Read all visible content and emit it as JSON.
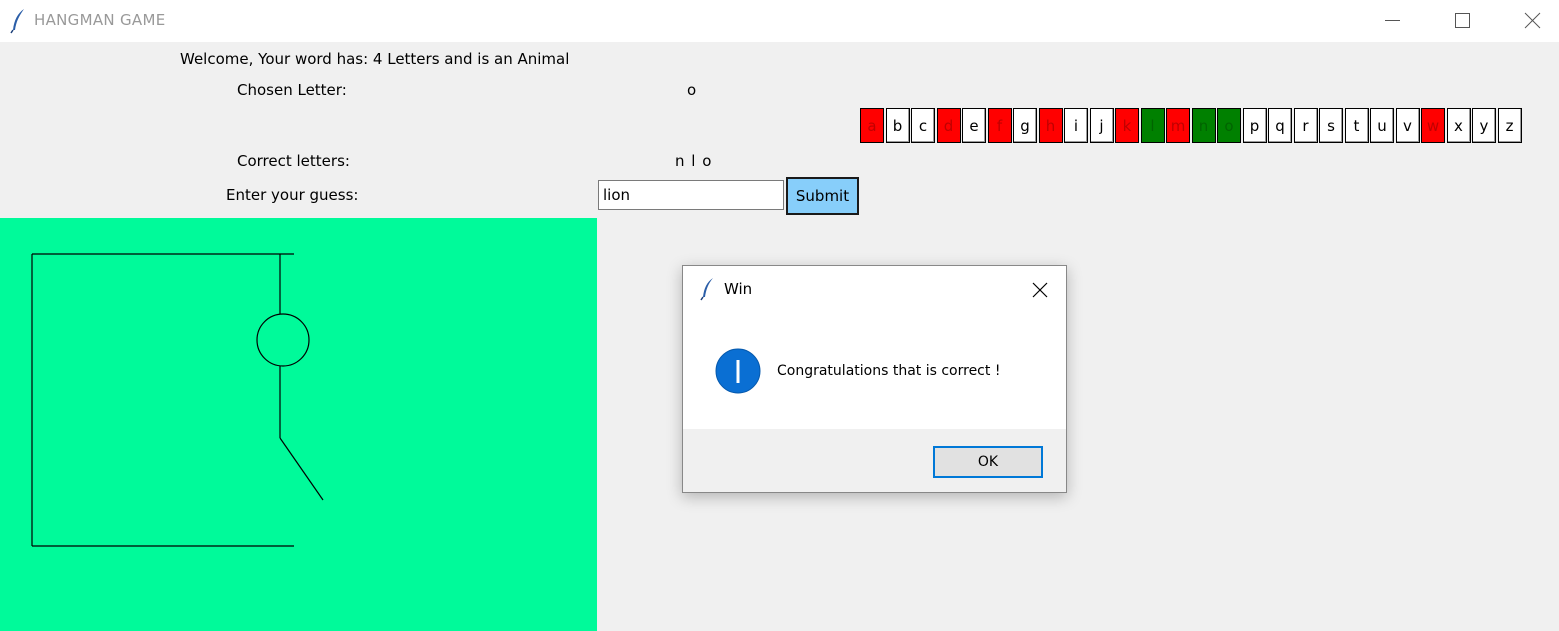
{
  "window": {
    "title": "HANGMAN GAME",
    "icon": "feather-icon"
  },
  "labels": {
    "welcome": "Welcome, Your word has:  4 Letters and is an Animal",
    "chosen_letter": "Chosen Letter:",
    "chosen_letter_value": "o",
    "correct_letters": "Correct letters:",
    "correct_letters_value": "n l o",
    "enter_guess": "Enter your guess:"
  },
  "guess": {
    "value": "lion",
    "submit_label": "Submit"
  },
  "letters": [
    {
      "char": "a",
      "state": "wrong"
    },
    {
      "char": "b",
      "state": "unused"
    },
    {
      "char": "c",
      "state": "unused"
    },
    {
      "char": "d",
      "state": "wrong"
    },
    {
      "char": "e",
      "state": "unused"
    },
    {
      "char": "f",
      "state": "wrong"
    },
    {
      "char": "g",
      "state": "unused"
    },
    {
      "char": "h",
      "state": "wrong"
    },
    {
      "char": "i",
      "state": "unused"
    },
    {
      "char": "j",
      "state": "unused"
    },
    {
      "char": "k",
      "state": "wrong"
    },
    {
      "char": "l",
      "state": "correct"
    },
    {
      "char": "m",
      "state": "wrong"
    },
    {
      "char": "n",
      "state": "correct"
    },
    {
      "char": "o",
      "state": "correct"
    },
    {
      "char": "p",
      "state": "unused"
    },
    {
      "char": "q",
      "state": "unused"
    },
    {
      "char": "r",
      "state": "unused"
    },
    {
      "char": "s",
      "state": "unused"
    },
    {
      "char": "t",
      "state": "unused"
    },
    {
      "char": "u",
      "state": "unused"
    },
    {
      "char": "v",
      "state": "unused"
    },
    {
      "char": "w",
      "state": "wrong"
    },
    {
      "char": "x",
      "state": "unused"
    },
    {
      "char": "y",
      "state": "unused"
    },
    {
      "char": "z",
      "state": "unused"
    }
  ],
  "colors": {
    "canvas": "#00fa9a",
    "wrong": "#ff0000",
    "correct": "#008000",
    "submit": "#87cefa",
    "accent": "#0078d7"
  },
  "dialog": {
    "title": "Win",
    "message": "Congratulations that is correct !",
    "ok_label": "OK",
    "icon": "info-icon"
  }
}
